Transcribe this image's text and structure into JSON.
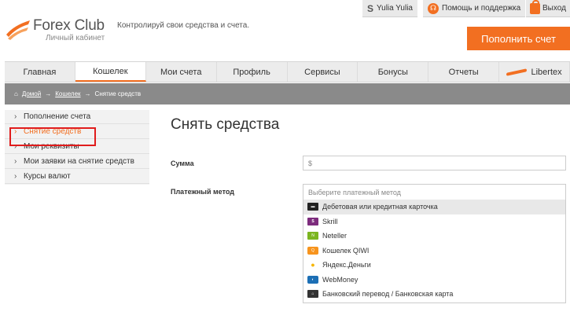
{
  "brand": {
    "name": "Forex Club",
    "subtitle": "Личный кабинет",
    "tagline": "Контролируй свои средства и счета."
  },
  "topbar": {
    "user": "Yulia Yulia",
    "help": "Помощь и поддержка",
    "exit": "Выход"
  },
  "deposit_button": "Пополнить счет",
  "nav": [
    {
      "label": "Главная",
      "active": false
    },
    {
      "label": "Кошелек",
      "active": true
    },
    {
      "label": "Мои счета",
      "active": false
    },
    {
      "label": "Профиль",
      "active": false
    },
    {
      "label": "Сервисы",
      "active": false
    },
    {
      "label": "Бонусы",
      "active": false
    },
    {
      "label": "Отчеты",
      "active": false
    },
    {
      "label": "Libertex",
      "active": false
    }
  ],
  "breadcrumb": {
    "home": "Домой",
    "wallet": "Кошелек",
    "current": "Снятие средств",
    "sep": "→"
  },
  "sidebar": [
    {
      "label": "Пополнение счета",
      "active": false
    },
    {
      "label": "Снятие средств",
      "active": true
    },
    {
      "label": "Мои реквизиты",
      "active": false
    },
    {
      "label": "Мои заявки на снятие средств",
      "active": false
    },
    {
      "label": "Курсы валют",
      "active": false
    }
  ],
  "main": {
    "title": "Снять средства",
    "amount_label": "Сумма",
    "amount_value": "$",
    "method_label": "Платежный метод",
    "method_placeholder": "Выберите платежный метод",
    "methods": [
      {
        "label": "Дебетовая или кредитная карточка",
        "icon": "card-icon"
      },
      {
        "label": "Skrill",
        "icon": "skrill-icon"
      },
      {
        "label": "Neteller",
        "icon": "neteller-icon"
      },
      {
        "label": "Кошелек QIWI",
        "icon": "qiwi-icon"
      },
      {
        "label": "Яндекс.Деньги",
        "icon": "yandex-money-icon"
      },
      {
        "label": "WebMoney",
        "icon": "webmoney-icon"
      },
      {
        "label": "Банковский перевод / Банковская карта",
        "icon": "bank-icon"
      }
    ]
  },
  "colors": {
    "accent": "#f26f21",
    "highlight": "#e01c1c",
    "breadcrumb_bg": "#8a8a8a"
  }
}
